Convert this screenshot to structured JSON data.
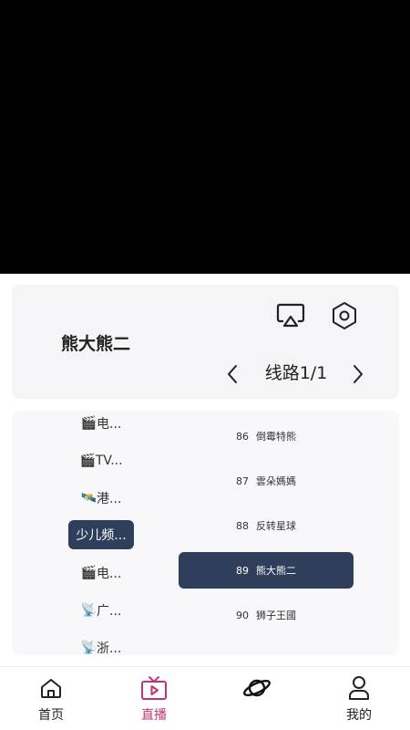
{
  "player": {
    "state": "black"
  },
  "info": {
    "channel_title": "熊大熊二",
    "route_label": "线路1/1",
    "icons": {
      "cast": "airplay-icon",
      "settings": "hexagon-settings-icon",
      "prev": "chevron-left-icon",
      "next": "chevron-right-icon"
    }
  },
  "categories": [
    {
      "icon": "🎬",
      "label": "电..."
    },
    {
      "icon": "🎬",
      "label": "TV..."
    },
    {
      "icon": "🛰️",
      "label": "港..."
    },
    {
      "icon": "",
      "label": "少儿频..."
    },
    {
      "icon": "🎬",
      "label": "电..."
    },
    {
      "icon": "📡",
      "label": "广..."
    },
    {
      "icon": "📡",
      "label": "浙..."
    }
  ],
  "active_category_index": 3,
  "channels": [
    {
      "num": "86",
      "name": "倒霉特熊"
    },
    {
      "num": "87",
      "name": "雲朵媽媽"
    },
    {
      "num": "88",
      "name": "反转星球"
    },
    {
      "num": "89",
      "name": "熊大熊二"
    },
    {
      "num": "90",
      "name": "狮子王國"
    }
  ],
  "active_channel_index": 3,
  "nav": {
    "home": "首页",
    "live": "直播",
    "discover": "",
    "mine": "我的",
    "accent": "#c2337a"
  }
}
